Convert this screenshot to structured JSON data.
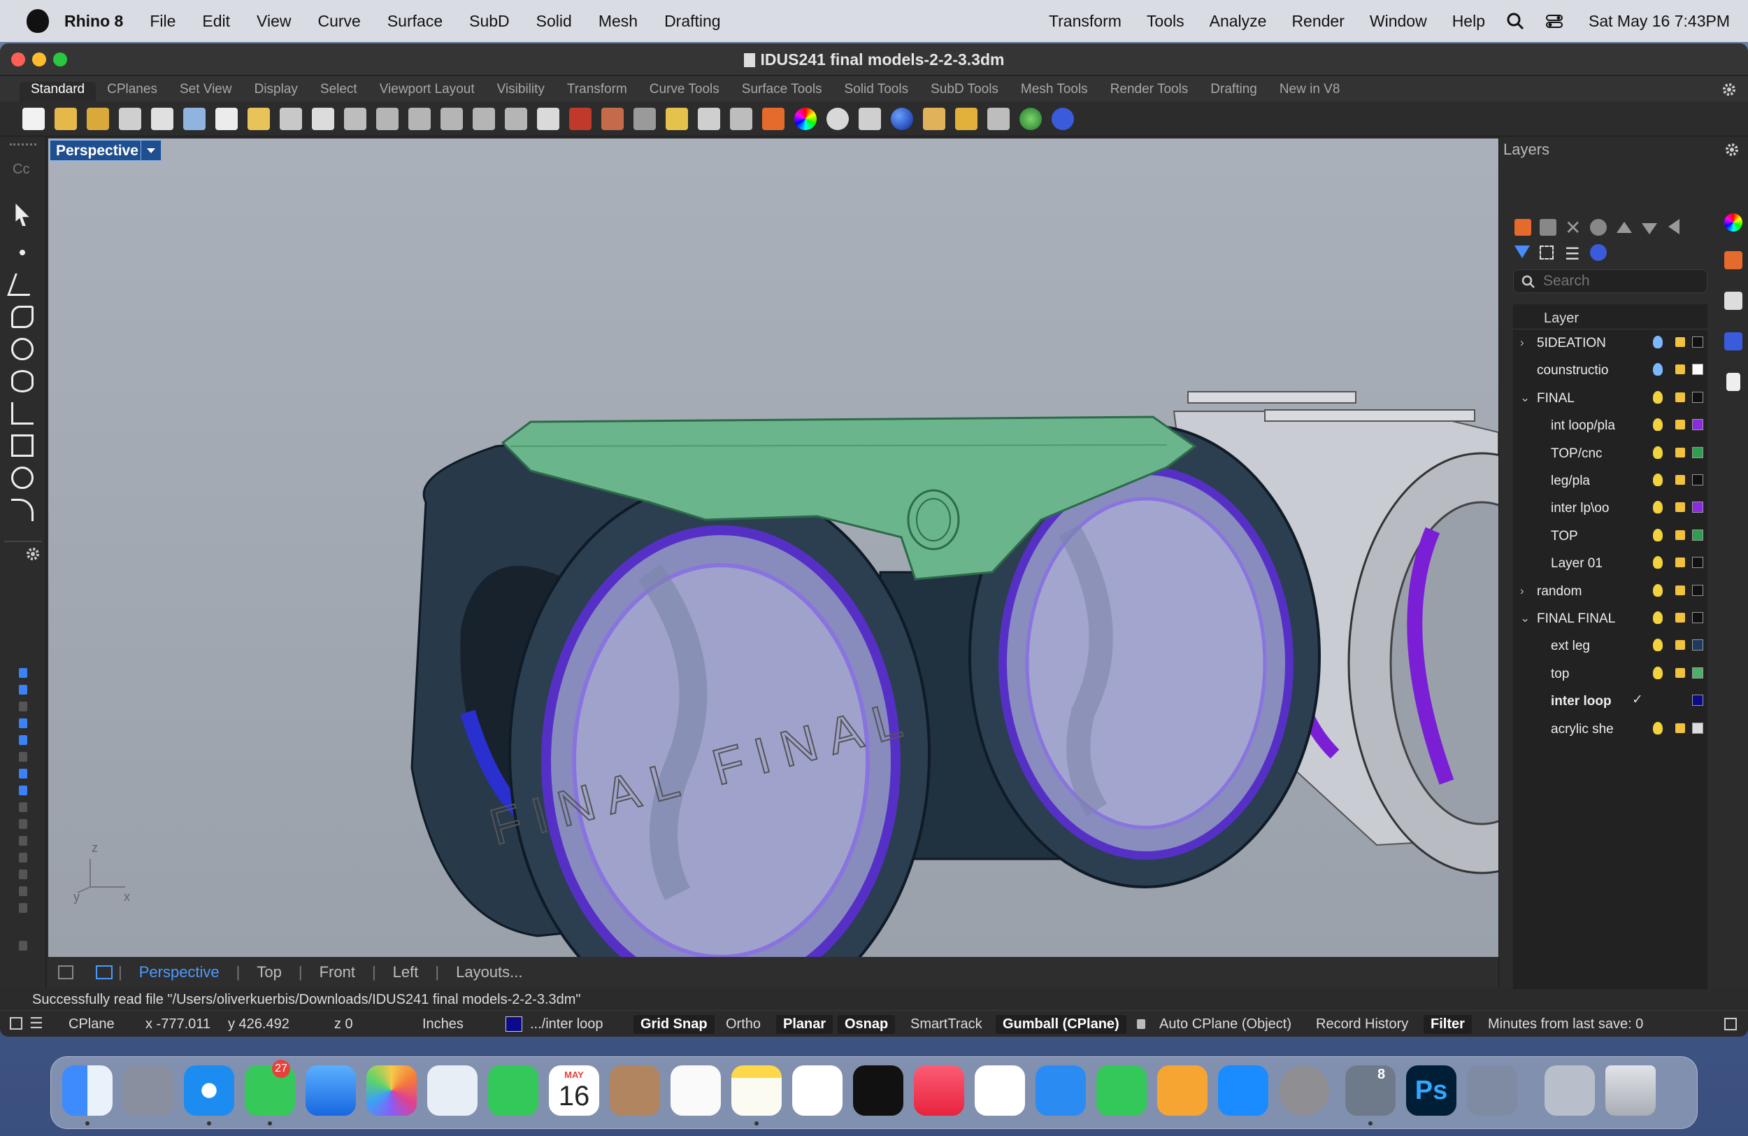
{
  "menubar": {
    "app": "Rhino 8",
    "items": [
      "File",
      "Edit",
      "View",
      "Curve",
      "Surface",
      "SubD",
      "Solid",
      "Mesh",
      "Drafting"
    ],
    "right_items": [
      "Transform",
      "Tools",
      "Analyze",
      "Render",
      "Window",
      "Help"
    ],
    "clock": "Sat May 16  7:43PM"
  },
  "window": {
    "title": "IDUS241 final models-2-2-3.3dm"
  },
  "tabs": [
    "Standard",
    "CPlanes",
    "Set View",
    "Display",
    "Select",
    "Viewport Layout",
    "Visibility",
    "Transform",
    "Curve Tools",
    "Surface Tools",
    "Solid Tools",
    "SubD Tools",
    "Mesh Tools",
    "Render Tools",
    "Drafting",
    "New in V8"
  ],
  "left_toolbar": {
    "command_abbrev": "Cc"
  },
  "viewport": {
    "name": "Perspective",
    "scene_text": "FINAL FINAL",
    "axis": {
      "z": "z",
      "y": "y",
      "x": "x"
    }
  },
  "viewport_tabs": [
    "Perspective",
    "Top",
    "Front",
    "Left",
    "Layouts..."
  ],
  "layers": {
    "panel_title": "Layers",
    "search_placeholder": "Search",
    "column_header": "Layer",
    "rows": [
      {
        "name": "5IDEATION",
        "indent": 0,
        "expander": "›",
        "bulb": "blue",
        "color": "#111111"
      },
      {
        "name": "counstructio",
        "indent": 0,
        "expander": "",
        "bulb": "blue",
        "color": "#ffffff"
      },
      {
        "name": "FINAL",
        "indent": 0,
        "expander": "⌄",
        "bulb": "yellow",
        "color": "#111111"
      },
      {
        "name": "int loop/pla",
        "indent": 1,
        "expander": "",
        "bulb": "yellow",
        "color": "#8a2be2"
      },
      {
        "name": "TOP/cnc",
        "indent": 1,
        "expander": "",
        "bulb": "yellow",
        "color": "#2e9e4f"
      },
      {
        "name": "leg/pla",
        "indent": 1,
        "expander": "",
        "bulb": "yellow",
        "color": "#111111"
      },
      {
        "name": "inter lp\\oo",
        "indent": 1,
        "expander": "",
        "bulb": "yellow",
        "color": "#8a2be2"
      },
      {
        "name": "TOP",
        "indent": 1,
        "expander": "",
        "bulb": "yellow",
        "color": "#2e9e4f"
      },
      {
        "name": "Layer 01",
        "indent": 1,
        "expander": "",
        "bulb": "yellow",
        "color": "#111111"
      },
      {
        "name": "random",
        "indent": 0,
        "expander": "›",
        "bulb": "yellow",
        "color": "#111111"
      },
      {
        "name": "FINAL FINAL",
        "indent": 0,
        "expander": "⌄",
        "bulb": "yellow",
        "color": "#111111"
      },
      {
        "name": "ext leg",
        "indent": 1,
        "expander": "",
        "bulb": "yellow",
        "color": "#1e3a5f"
      },
      {
        "name": "top",
        "indent": 1,
        "expander": "",
        "bulb": "yellow",
        "color": "#4caf6a"
      },
      {
        "name": "inter loop",
        "indent": 1,
        "expander": "",
        "bulb": "none",
        "color": "#0a0a8a",
        "current": true,
        "check": "✓"
      },
      {
        "name": "acrylic she",
        "indent": 1,
        "expander": "",
        "bulb": "yellow",
        "color": "#dddddd"
      }
    ]
  },
  "command_line": "Successfully read file \"/Users/oliverkuerbis/Downloads/IDUS241 final models-2-2-3.3dm\"",
  "status": {
    "cplane": "CPlane",
    "x": "x -777.011",
    "y": "y 426.492",
    "z": "z 0",
    "units": "Inches",
    "layer": ".../inter loop",
    "layer_color": "#0a0a8a",
    "grid_snap": "Grid Snap",
    "ortho": "Ortho",
    "planar": "Planar",
    "osnap": "Osnap",
    "smarttrack": "SmartTrack",
    "gumball": "Gumball (CPlane)",
    "auto_cplane": "Auto CPlane (Object)",
    "record_history": "Record History",
    "filter": "Filter",
    "minutes": "Minutes from last save: 0"
  },
  "dock": {
    "messages_badge": "27",
    "calendar_month": "MAY",
    "calendar_day": "16",
    "rhino_version": "8",
    "ps_label": "Ps"
  }
}
